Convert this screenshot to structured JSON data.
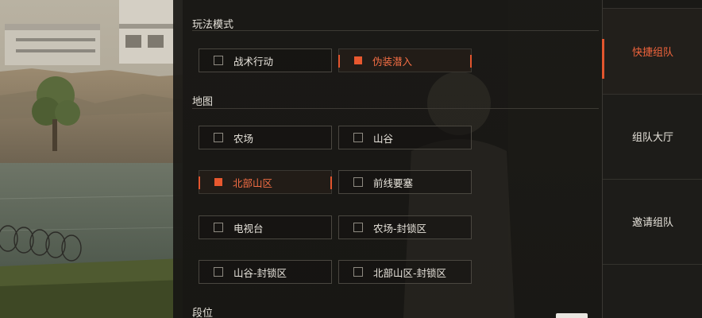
{
  "sections": {
    "mode": {
      "title": "玩法模式",
      "options": [
        {
          "label": "战术行动",
          "selected": false
        },
        {
          "label": "伪装潜入",
          "selected": true
        }
      ]
    },
    "map": {
      "title": "地图",
      "options": [
        {
          "label": "农场",
          "selected": false
        },
        {
          "label": "山谷",
          "selected": false
        },
        {
          "label": "北部山区",
          "selected": true
        },
        {
          "label": "前线要塞",
          "selected": false
        },
        {
          "label": "电视台",
          "selected": false
        },
        {
          "label": "农场-封锁区",
          "selected": false
        },
        {
          "label": "山谷-封锁区",
          "selected": false
        },
        {
          "label": "北部山区-封锁区",
          "selected": false
        }
      ]
    },
    "rank": {
      "title": "段位"
    }
  },
  "sidebar": {
    "items": [
      {
        "label": "快捷组队",
        "active": true
      },
      {
        "label": "组队大厅",
        "active": false
      },
      {
        "label": "邀请组队",
        "active": false
      }
    ]
  },
  "colors": {
    "accent": "#e2552e",
    "accent_text": "#f26d44",
    "text": "#e8e4dc",
    "panel": "#1a1916"
  }
}
